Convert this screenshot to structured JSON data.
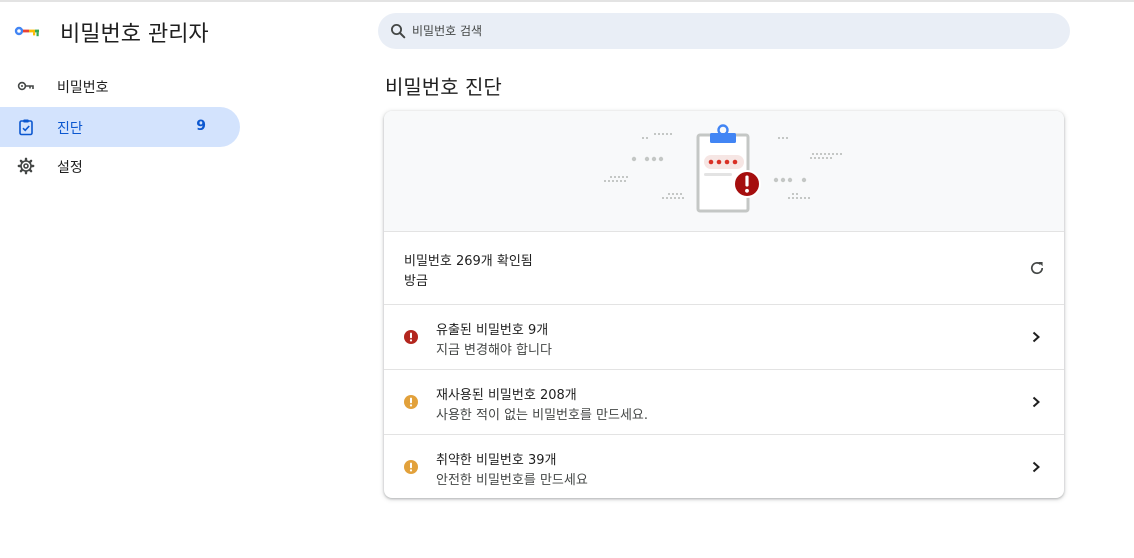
{
  "app": {
    "title": "비밀번호 관리자",
    "logo_icon": "key-logo-icon"
  },
  "search": {
    "placeholder": "비밀번호 검색",
    "value": "",
    "icon": "search-icon"
  },
  "sidebar": {
    "items": [
      {
        "label": "비밀번호",
        "icon": "key-icon",
        "active": false
      },
      {
        "label": "진단",
        "icon": "clipboard-check-icon",
        "active": true,
        "count": "9"
      },
      {
        "label": "설정",
        "icon": "gear-icon",
        "active": false
      }
    ]
  },
  "main": {
    "title": "비밀번호 진단",
    "summary": {
      "title": "비밀번호 269개 확인됨",
      "subtitle": "방금",
      "refresh_icon": "refresh-icon"
    },
    "issues": [
      {
        "title": "유출된 비밀번호 9개",
        "subtitle": "지금 변경해야 합니다",
        "severity": "critical",
        "color": "#b3261e",
        "icon": "error-icon"
      },
      {
        "title": "재사용된 비밀번호 208개",
        "subtitle": "사용한 적이 없는 비밀번호를 만드세요.",
        "severity": "warning",
        "color": "#e2a13b",
        "icon": "warning-icon"
      },
      {
        "title": "취약한 비밀번호 39개",
        "subtitle": "안전한 비밀번호를 만드세요",
        "severity": "warning",
        "color": "#e2a13b",
        "icon": "warning-icon"
      }
    ]
  },
  "colors": {
    "accent": "#0b57d0",
    "nav_active_bg": "#d3e3fd",
    "search_bg": "#e9eef6",
    "critical": "#b3261e",
    "warning": "#e2a13b"
  }
}
